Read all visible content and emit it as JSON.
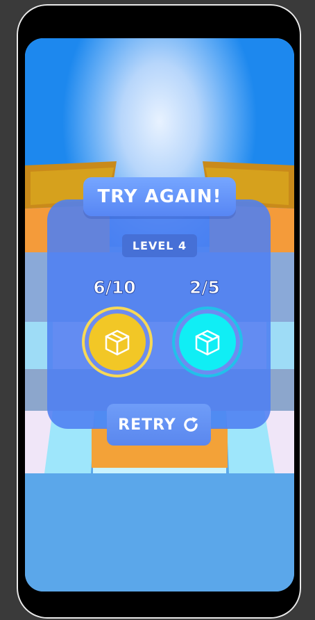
{
  "screen": {
    "title": "TRY AGAIN!",
    "level_label": "LEVEL 4",
    "counters": [
      {
        "value": "6/10",
        "color": "#f2c726",
        "icon": "box-icon"
      },
      {
        "value": "2/5",
        "color": "#10eef5",
        "icon": "box-icon"
      }
    ],
    "retry_label": "RETRY",
    "retry_icon": "refresh-icon"
  },
  "colors": {
    "panel": "#4e7ff1",
    "frame": "#3a3a3a"
  }
}
